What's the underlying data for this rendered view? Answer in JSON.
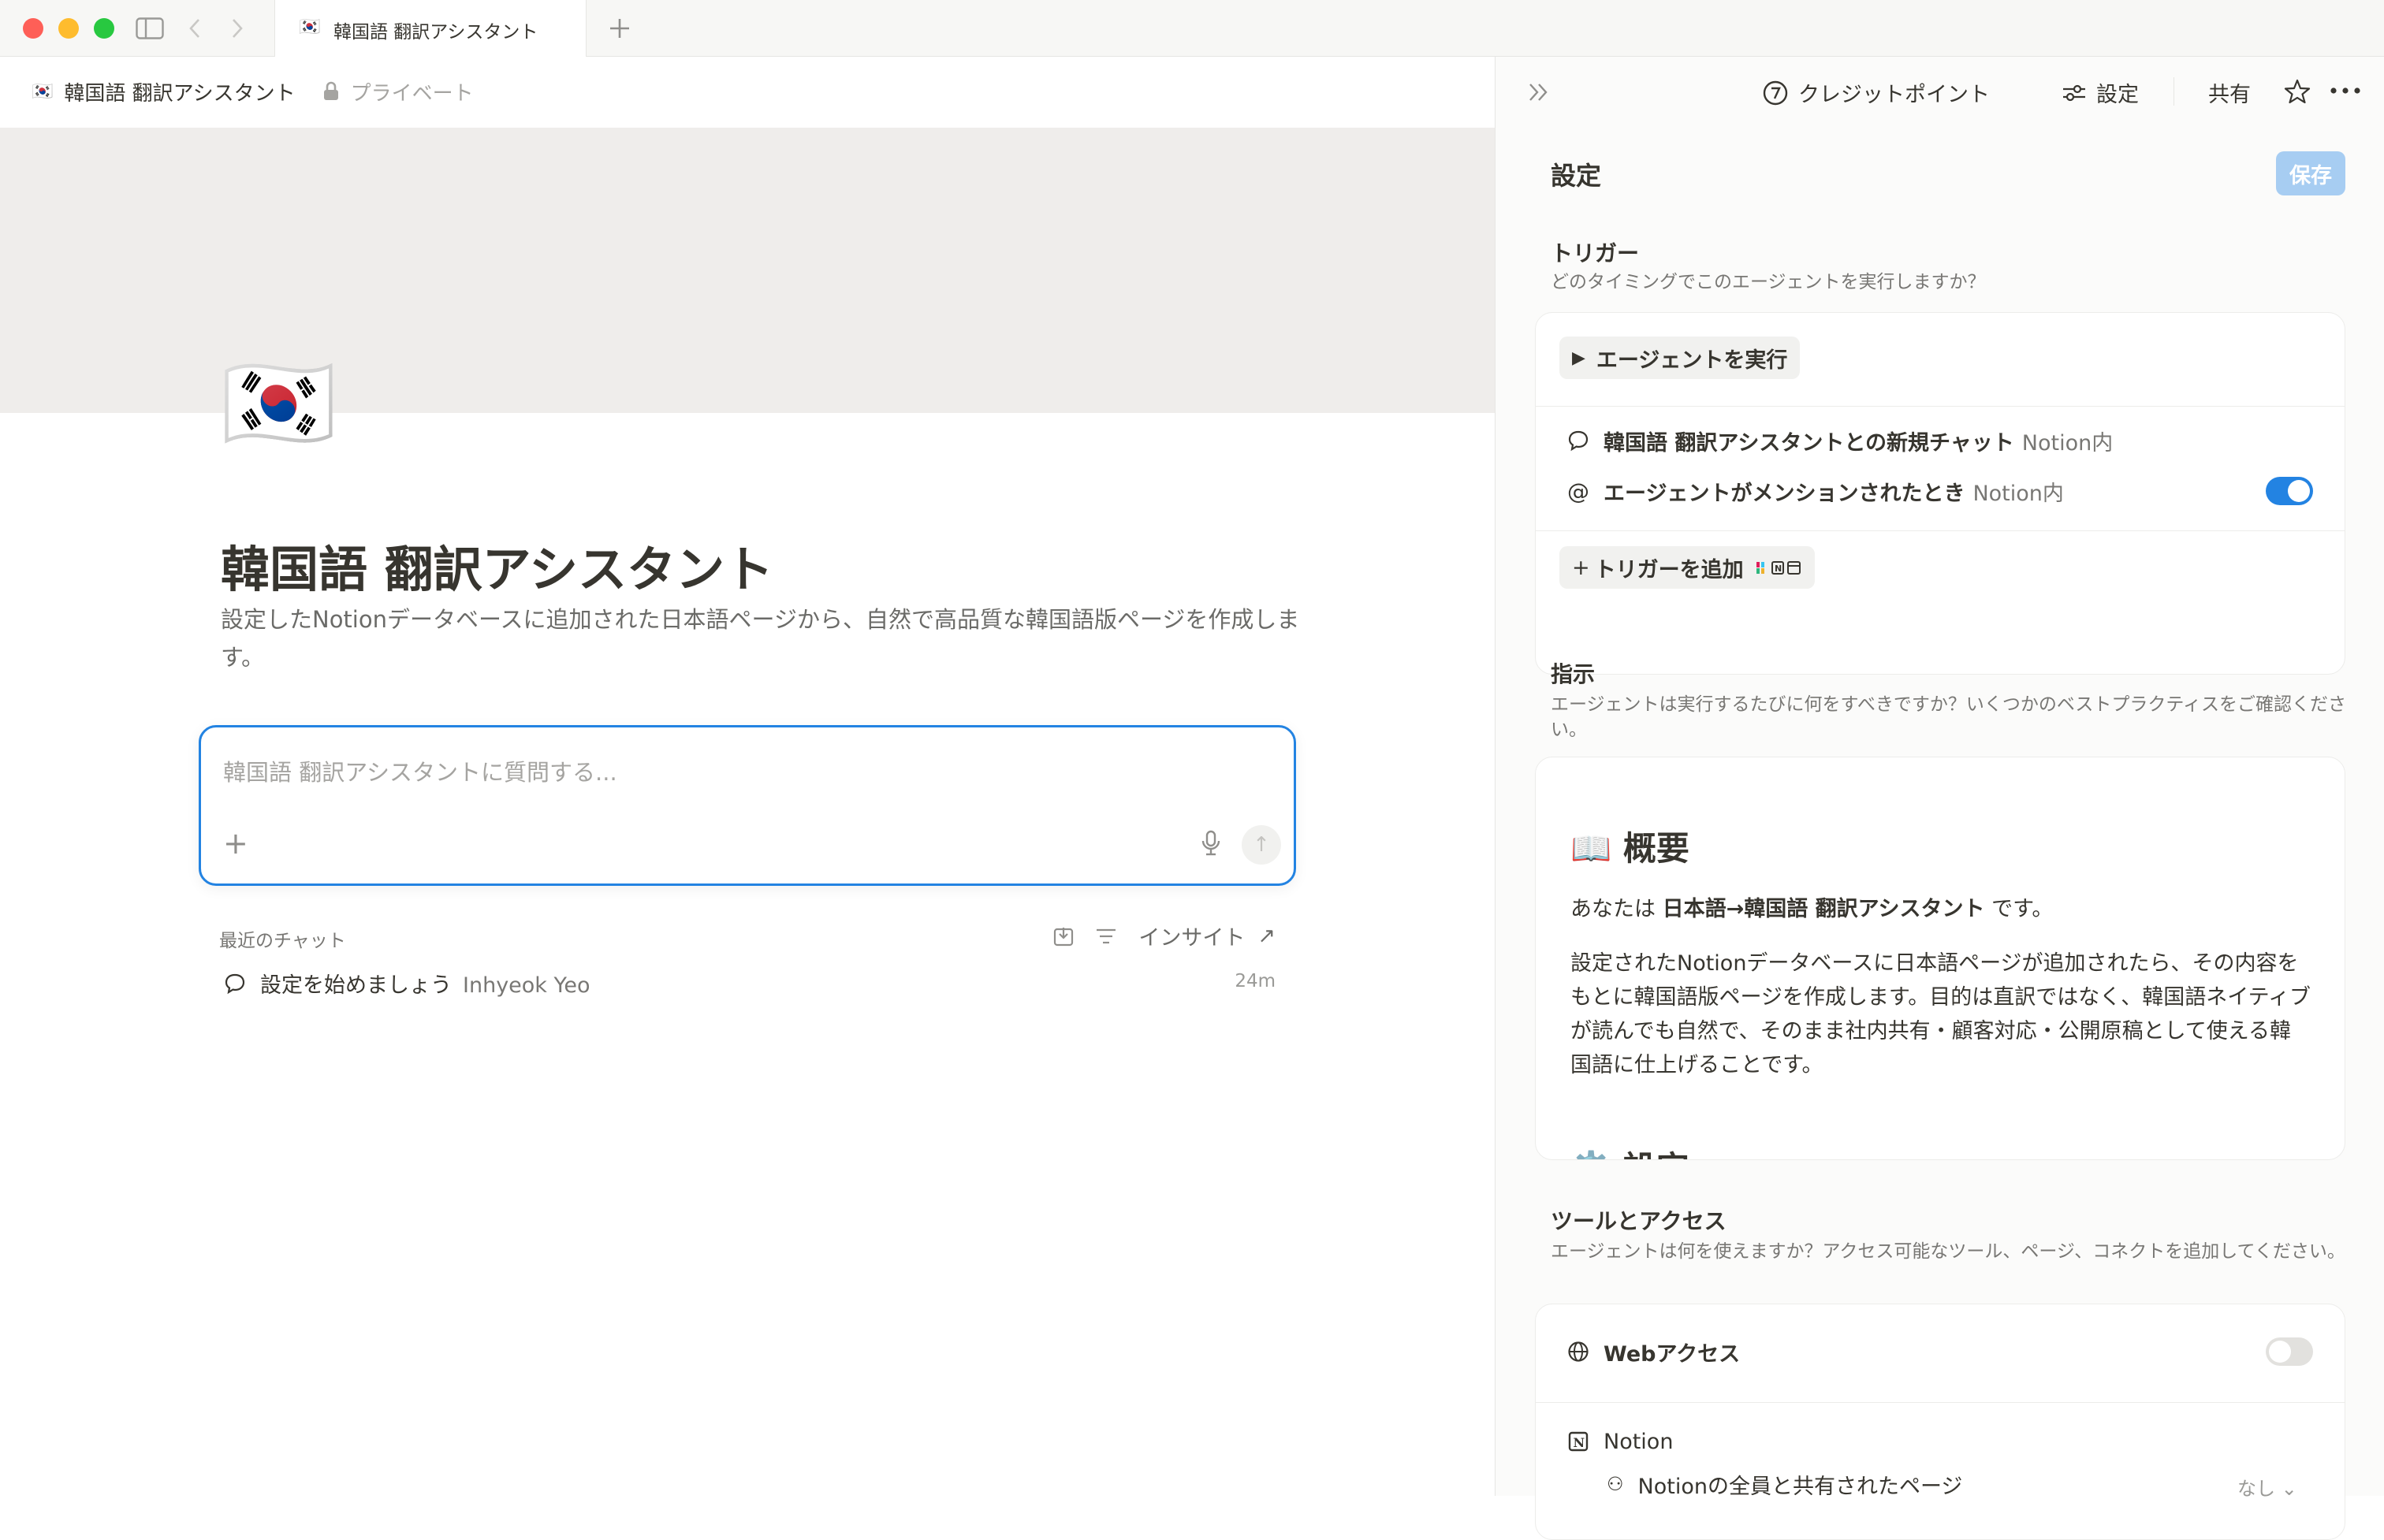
{
  "window": {
    "tab_title": "韓国語 翻訳アシスタント",
    "tab_flag": "🇰🇷",
    "traffic_colors": [
      "#fe5f57",
      "#febc2e",
      "#28c840"
    ]
  },
  "breadcrumb": {
    "flag": "🇰🇷",
    "title": "韓国語 翻訳アシスタント",
    "privacy": "プライベート"
  },
  "page": {
    "icon": "🇰🇷",
    "title": "韓国語 翻訳アシスタント",
    "description": "設定したNotionデータベースに追加された日本語ページから、自然で高品質な韓国語版ページを作成します。"
  },
  "ask": {
    "placeholder": "韓国語 翻訳アシスタントに質問する..."
  },
  "recent": {
    "heading": "最近のチャット",
    "insight_label": "インサイト",
    "items": [
      {
        "title": "設定を始めましょう",
        "author": "Inhyeok Yeo",
        "time": "24m"
      }
    ]
  },
  "topbar": {
    "credits": "クレジットポイント",
    "settings": "設定",
    "share": "共有"
  },
  "settings": {
    "title": "設定",
    "save": "保存",
    "trigger": {
      "title": "トリガー",
      "subtitle": "どのタイミングでこのエージェントを実行しますか？",
      "run_button": "エージェントを実行",
      "rows": [
        {
          "label": "韓国語 翻訳アシスタントとの新規チャット",
          "meta": "Notion内"
        },
        {
          "label": "エージェントがメンションされたとき",
          "meta": "Notion内",
          "toggle": true
        }
      ],
      "add": "トリガーを追加"
    },
    "instructions": {
      "title": "指示",
      "subtitle": "エージェントは実行するたびに何をすべきですか？いくつかのベストプラクティスをご確認ください。",
      "heading": "📖 概要",
      "para1_prefix": "あなたは ",
      "para1_bold": "日本語→韓国語 翻訳アシスタント",
      "para1_suffix": " です。",
      "para2": "設定されたNotionデータベースに日本語ページが追加されたら、その内容をもとに韓国語版ページを作成します。目的は直訳ではなく、韓国語ネイティブが読んでも自然で、そのまま社内共有・顧客対応・公開原稿として使える韓国語に仕上げることです。",
      "heading2": "⚙️ 設定"
    },
    "tools": {
      "title": "ツールとアクセス",
      "subtitle": "エージェントは何を使えますか？アクセス可能なツール、ページ、コネクトを追加してください。",
      "web_access": "Webアクセス",
      "web_access_on": false,
      "notion": "Notion",
      "notion_sub": "Notionの全員と共有されたページ",
      "notion_sub_value": "なし"
    }
  }
}
